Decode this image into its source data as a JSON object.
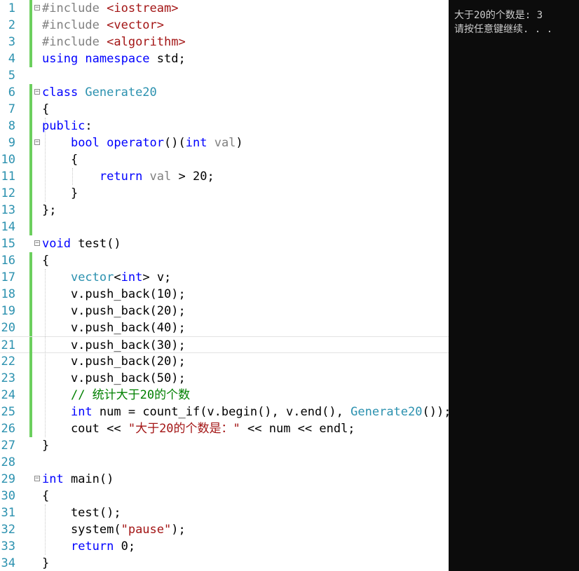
{
  "editor": {
    "lines": [
      {
        "n": "1",
        "parts": [
          {
            "t": "#include ",
            "c": "pp"
          },
          {
            "t": "<iostream>",
            "c": "st"
          }
        ],
        "fold": true,
        "bar": true
      },
      {
        "n": "2",
        "parts": [
          {
            "t": "#include ",
            "c": "pp"
          },
          {
            "t": "<vector>",
            "c": "st"
          }
        ],
        "bar": true
      },
      {
        "n": "3",
        "parts": [
          {
            "t": "#include ",
            "c": "pp"
          },
          {
            "t": "<algorithm>",
            "c": "st"
          }
        ],
        "bar": true
      },
      {
        "n": "4",
        "parts": [
          {
            "t": "using namespace ",
            "c": "kw"
          },
          {
            "t": "std;",
            "c": ""
          }
        ],
        "bar": true
      },
      {
        "n": "5",
        "parts": []
      },
      {
        "n": "6",
        "parts": [
          {
            "t": "class ",
            "c": "kw"
          },
          {
            "t": "Generate20",
            "c": "ty"
          }
        ],
        "fold": true,
        "bar": true
      },
      {
        "n": "7",
        "parts": [
          {
            "t": "{",
            "c": ""
          }
        ],
        "bar": true
      },
      {
        "n": "8",
        "parts": [
          {
            "t": "public",
            "c": "kw"
          },
          {
            "t": ":",
            "c": ""
          }
        ],
        "bar": true
      },
      {
        "n": "9",
        "parts": [
          {
            "t": "    ",
            "c": ""
          },
          {
            "t": "bool ",
            "c": "kw"
          },
          {
            "t": "operator",
            "c": "kw"
          },
          {
            "t": "()(",
            "c": ""
          },
          {
            "t": "int ",
            "c": "kw"
          },
          {
            "t": "val",
            "c": "prm"
          },
          {
            "t": ")",
            "c": ""
          }
        ],
        "fold": true,
        "bar": true
      },
      {
        "n": "10",
        "parts": [
          {
            "t": "    {",
            "c": ""
          }
        ],
        "bar": true
      },
      {
        "n": "11",
        "parts": [
          {
            "t": "        ",
            "c": ""
          },
          {
            "t": "return ",
            "c": "kw"
          },
          {
            "t": "val",
            "c": "prm"
          },
          {
            "t": " > 20;",
            "c": ""
          }
        ],
        "bar": true
      },
      {
        "n": "12",
        "parts": [
          {
            "t": "    }",
            "c": ""
          }
        ],
        "bar": true
      },
      {
        "n": "13",
        "parts": [
          {
            "t": "};",
            "c": ""
          }
        ],
        "bar": true
      },
      {
        "n": "14",
        "parts": [],
        "bar": true
      },
      {
        "n": "15",
        "parts": [
          {
            "t": "void ",
            "c": "kw"
          },
          {
            "t": "test()",
            "c": ""
          }
        ],
        "fold": true
      },
      {
        "n": "16",
        "parts": [
          {
            "t": "{",
            "c": ""
          }
        ],
        "bar": true
      },
      {
        "n": "17",
        "parts": [
          {
            "t": "    ",
            "c": ""
          },
          {
            "t": "vector",
            "c": "ty"
          },
          {
            "t": "<",
            "c": ""
          },
          {
            "t": "int",
            "c": "kw"
          },
          {
            "t": "> v;",
            "c": ""
          }
        ],
        "bar": true
      },
      {
        "n": "18",
        "parts": [
          {
            "t": "    v.push_back(10);",
            "c": ""
          }
        ],
        "bar": true
      },
      {
        "n": "19",
        "parts": [
          {
            "t": "    v.push_back(20);",
            "c": ""
          }
        ],
        "bar": true
      },
      {
        "n": "20",
        "parts": [
          {
            "t": "    v.push_back(40);",
            "c": ""
          }
        ],
        "bar": true
      },
      {
        "n": "21",
        "parts": [
          {
            "t": "    v.push_back(30);",
            "c": ""
          }
        ],
        "bar": true,
        "current": true
      },
      {
        "n": "22",
        "parts": [
          {
            "t": "    v.push_back(20);",
            "c": ""
          }
        ],
        "bar": true
      },
      {
        "n": "23",
        "parts": [
          {
            "t": "    v.push_back(50);",
            "c": ""
          }
        ],
        "bar": true
      },
      {
        "n": "24",
        "parts": [
          {
            "t": "    ",
            "c": ""
          },
          {
            "t": "// 统计大于20的个数",
            "c": "cm"
          }
        ],
        "bar": true
      },
      {
        "n": "25",
        "parts": [
          {
            "t": "    ",
            "c": ""
          },
          {
            "t": "int ",
            "c": "kw"
          },
          {
            "t": "num = count_if(v.begin(), v.end(), ",
            "c": ""
          },
          {
            "t": "Generate20",
            "c": "ty"
          },
          {
            "t": "());",
            "c": ""
          }
        ],
        "bar": true
      },
      {
        "n": "26",
        "parts": [
          {
            "t": "    cout << ",
            "c": ""
          },
          {
            "t": "\"大于20的个数是：\"",
            "c": "st"
          },
          {
            "t": " << num << endl;",
            "c": ""
          }
        ],
        "bar": true
      },
      {
        "n": "27",
        "parts": [
          {
            "t": "}",
            "c": ""
          }
        ]
      },
      {
        "n": "28",
        "parts": []
      },
      {
        "n": "29",
        "parts": [
          {
            "t": "int ",
            "c": "kw"
          },
          {
            "t": "main()",
            "c": ""
          }
        ],
        "fold": true
      },
      {
        "n": "30",
        "parts": [
          {
            "t": "{",
            "c": ""
          }
        ]
      },
      {
        "n": "31",
        "parts": [
          {
            "t": "    test();",
            "c": ""
          }
        ]
      },
      {
        "n": "32",
        "parts": [
          {
            "t": "    system(",
            "c": ""
          },
          {
            "t": "\"pause\"",
            "c": "st"
          },
          {
            "t": ");",
            "c": ""
          }
        ]
      },
      {
        "n": "33",
        "parts": [
          {
            "t": "    ",
            "c": ""
          },
          {
            "t": "return ",
            "c": "kw"
          },
          {
            "t": "0;",
            "c": ""
          }
        ]
      },
      {
        "n": "34",
        "parts": [
          {
            "t": "}",
            "c": ""
          }
        ]
      }
    ]
  },
  "console": {
    "line1": "大于20的个数是: 3",
    "line2": "请按任意键继续. . ."
  },
  "colors": {
    "keyword": "#0000ff",
    "type": "#2b91af",
    "preprocessor": "#808080",
    "string": "#a31515",
    "comment": "#008000",
    "change_bar": "#6ccf5e",
    "console_bg": "#0c0c0c"
  }
}
